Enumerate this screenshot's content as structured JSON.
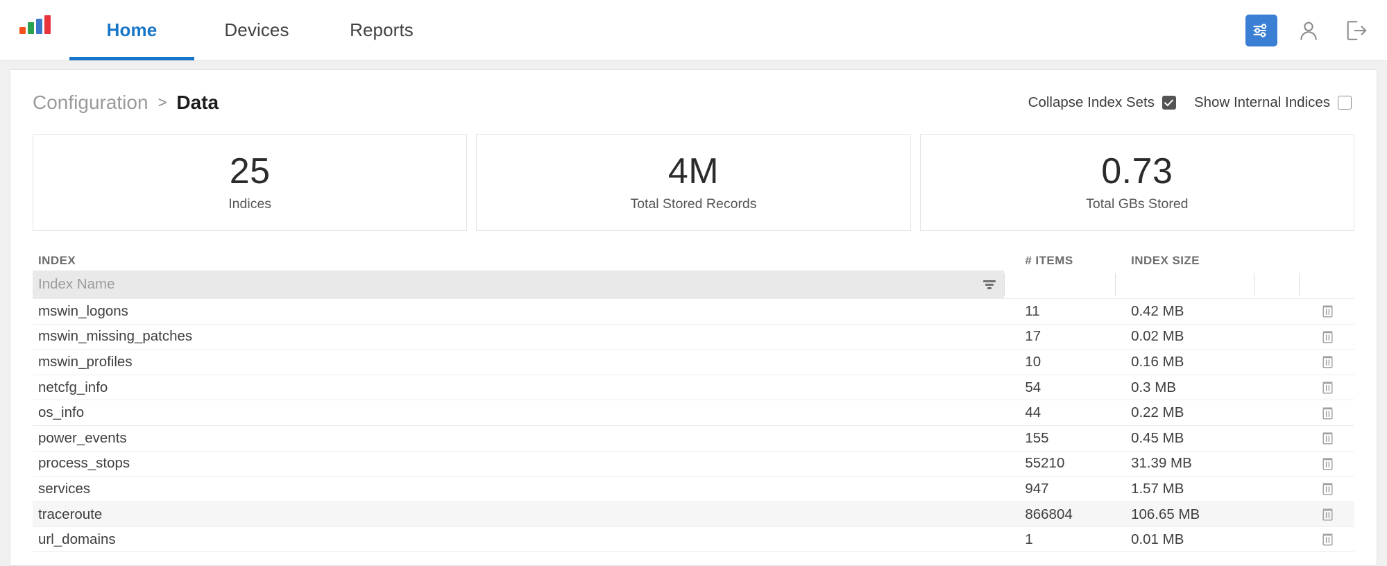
{
  "nav": {
    "logo_name": "app-logo-bars",
    "tabs": [
      {
        "label": "Home",
        "active": true
      },
      {
        "label": "Devices",
        "active": false
      },
      {
        "label": "Reports",
        "active": false
      }
    ],
    "icons": {
      "settings": "settings-sliders-icon",
      "user": "user-account-icon",
      "logout": "logout-icon"
    },
    "accent_color": "#1876c8"
  },
  "breadcrumb": {
    "parent": "Configuration",
    "separator": ">",
    "current": "Data"
  },
  "toggles": [
    {
      "label": "Collapse Index Sets",
      "checked": true
    },
    {
      "label": "Show Internal Indices",
      "checked": false
    }
  ],
  "stats": [
    {
      "value": "25",
      "label": "Indices"
    },
    {
      "value": "4M",
      "label": "Total Stored Records"
    },
    {
      "value": "0.73",
      "label": "Total GBs Stored"
    }
  ],
  "table": {
    "columns": {
      "index": "INDEX",
      "items": "# ITEMS",
      "size": "INDEX SIZE"
    },
    "filter": {
      "value": "",
      "placeholder": "Index Name",
      "icon": "filter-funnel-icon"
    },
    "row_action_icon": "delete-trash-icon",
    "rows": [
      {
        "index": "mswin_logons",
        "items": "11",
        "size": "0.42 MB",
        "hover": false
      },
      {
        "index": "mswin_missing_patches",
        "items": "17",
        "size": "0.02 MB",
        "hover": false
      },
      {
        "index": "mswin_profiles",
        "items": "10",
        "size": "0.16 MB",
        "hover": false
      },
      {
        "index": "netcfg_info",
        "items": "54",
        "size": "0.3 MB",
        "hover": false
      },
      {
        "index": "os_info",
        "items": "44",
        "size": "0.22 MB",
        "hover": false
      },
      {
        "index": "power_events",
        "items": "155",
        "size": "0.45 MB",
        "hover": false
      },
      {
        "index": "process_stops",
        "items": "55210",
        "size": "31.39 MB",
        "hover": false
      },
      {
        "index": "services",
        "items": "947",
        "size": "1.57 MB",
        "hover": false
      },
      {
        "index": "traceroute",
        "items": "866804",
        "size": "106.65 MB",
        "hover": true
      },
      {
        "index": "url_domains",
        "items": "1",
        "size": "0.01 MB",
        "hover": false
      }
    ]
  }
}
